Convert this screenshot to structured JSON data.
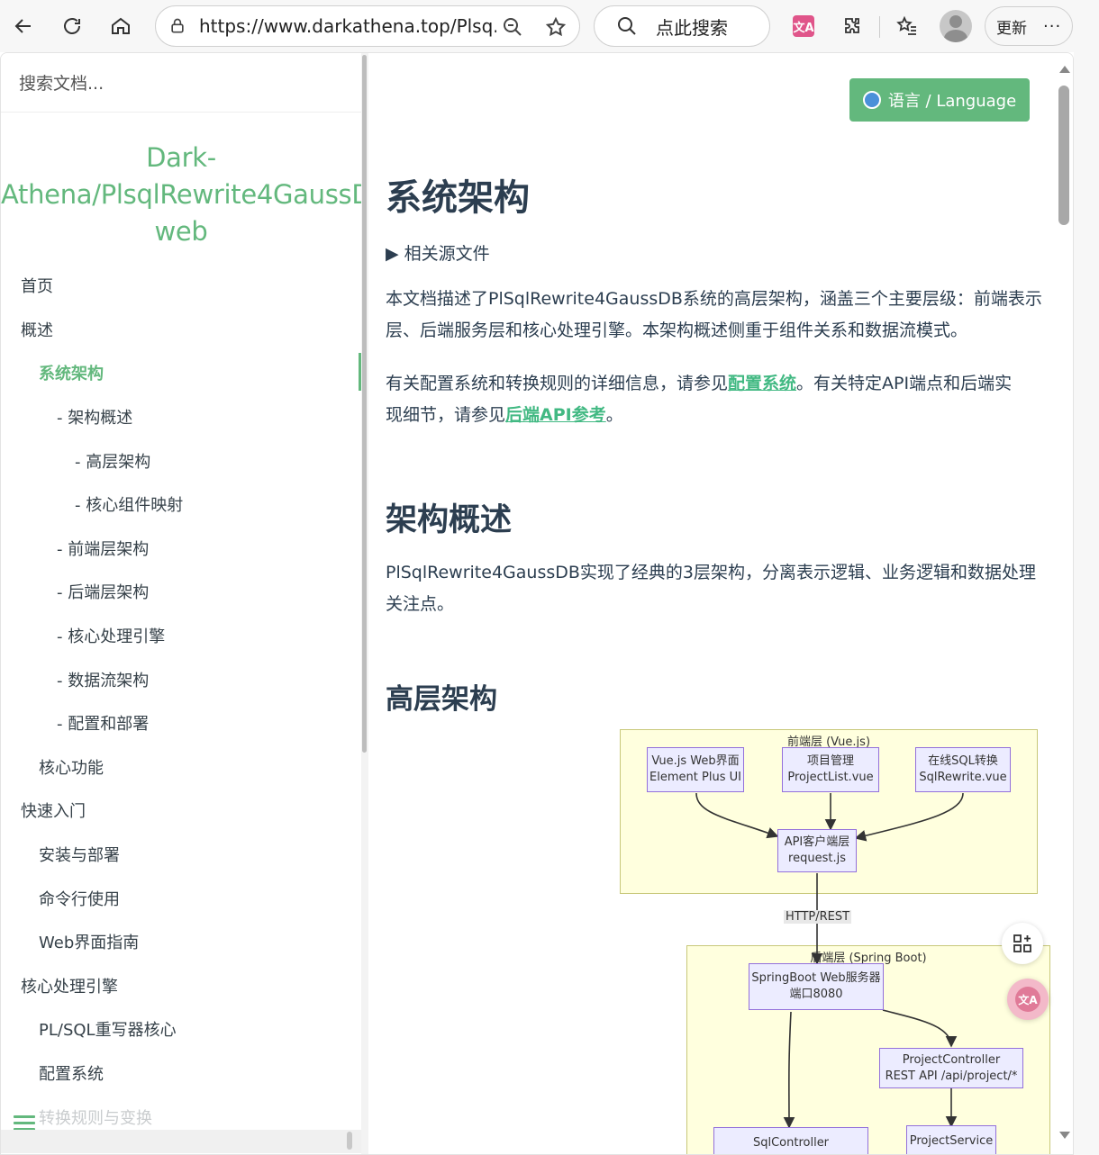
{
  "browser": {
    "url": "https://www.darkathena.top/Plsq...",
    "search_placeholder": "点此搜索",
    "update_label": "更新",
    "more_label": "···"
  },
  "sidebar": {
    "search_placeholder": "搜索文档...",
    "app_name_line1": "Dark-",
    "app_name_line2": "Athena/PlsqlRewrite4GaussDB",
    "app_name_line3": "web",
    "items": [
      {
        "label": "首页"
      },
      {
        "label": "概述"
      },
      {
        "label": "系统架构"
      },
      {
        "label": "- 架构概述"
      },
      {
        "label": "- 高层架构"
      },
      {
        "label": "- 核心组件映射"
      },
      {
        "label": "- 前端层架构"
      },
      {
        "label": "- 后端层架构"
      },
      {
        "label": "- 核心处理引擎"
      },
      {
        "label": "- 数据流架构"
      },
      {
        "label": "- 配置和部署"
      },
      {
        "label": "核心功能"
      },
      {
        "label": "快速入门"
      },
      {
        "label": "安装与部署"
      },
      {
        "label": "命令行使用"
      },
      {
        "label": "Web界面指南"
      },
      {
        "label": "核心处理引擎"
      },
      {
        "label": "PL/SQL重写器核心"
      },
      {
        "label": "配置系统"
      },
      {
        "label": "转换规则与变换"
      }
    ]
  },
  "content": {
    "language_button": "语言 / Language",
    "title": "系统架构",
    "details_label": "▶ 相关源文件",
    "intro_p1_line1": "本文档描述了PlSqlRewrite4GaussDB系统的高层架构，涵盖三个主要层级：前端表示",
    "intro_p1_line2": "层、后端服务层和核心处理引擎。本架构概述侧重于组件关系和数据流模式。",
    "intro_p2_a": "有关配置系统和转换规则的详细信息，请参见",
    "intro_p2_link1": "配置系统",
    "intro_p2_b": "。有关特定API端点和后端实",
    "intro_p2_c": "现细节，请参见",
    "intro_p2_link2": "后端API参考",
    "intro_p2_d": "。",
    "h2_overview": "架构概述",
    "overview_line1": "PlSqlRewrite4GaussDB实现了经典的3层架构，分离表示逻辑、业务逻辑和数据处理",
    "overview_line2": "关注点。",
    "h3_high_level": "高层架构"
  },
  "diagram": {
    "frontend_cluster": "前端层 (Vue.js)",
    "backend_cluster": "后端层 (Spring Boot)",
    "node_vue_line1": "Vue.js Web界面",
    "node_vue_line2": "Element Plus UI",
    "node_project_line1": "项目管理",
    "node_project_line2": "ProjectList.vue",
    "node_online_line1": "在线SQL转换",
    "node_online_line2": "SqlRewrite.vue",
    "node_api_line1": "API客户端层",
    "node_api_line2": "request.js",
    "edge_http": "HTTP/REST",
    "node_springboot_line1": "SpringBoot Web服务器",
    "node_springboot_line2": "端口8080",
    "node_projectcontroller_line1": "ProjectController",
    "node_projectcontroller_line2": "REST API /api/project/*",
    "node_sqlcontroller": "SqlController",
    "node_projectservice": "ProjectService"
  }
}
